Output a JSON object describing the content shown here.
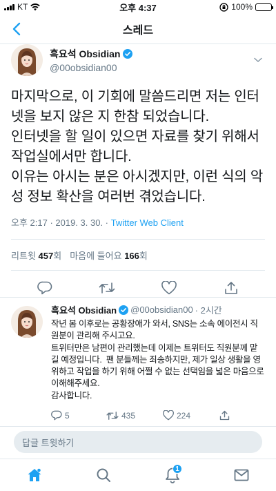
{
  "status_bar": {
    "carrier": "KT",
    "time": "오후 4:37",
    "battery": "100%",
    "battery_level": 1.0,
    "icons": [
      "signal-icon",
      "wifi-icon",
      "orientation-lock-icon",
      "battery-icon"
    ]
  },
  "nav": {
    "title": "스레드",
    "back_icon": "chevron-left-icon"
  },
  "main_tweet": {
    "display_name": "흑요석 Obsidian",
    "username": "@00obsidian00",
    "text": "마지막으로, 이 기회에 말씀드리면 저는 인터넷을 보지 않은 지 한참 되었습니다.\n인터넷을 할 일이 있으면 자료를 찾기 위해서 작업실에서만 합니다.\n이유는 아시는 분은 아시겠지만, 이런 식의 악성 정보 확산을 여러번 겪었습니다.",
    "timestamp": "오후 2:17 · 2019. 3. 30. · ",
    "client": "Twitter Web Client",
    "retweets_label": "리트윗",
    "retweets_count": "457",
    "retweets_unit": "회",
    "likes_label": "마음에 들어요",
    "likes_count": "166",
    "likes_unit": "회"
  },
  "reply_tweet": {
    "display_name": "흑요석 Obsidian",
    "username": "@00obsidian00",
    "time": "· 2시간",
    "text": "작년 봄 이후로는 공황장애가 와서, SNS는 소속 에이전시 직원분이 관리해 주시고요.\n트위터만은 남편이 관리했는데 이제는 트위터도 직원분께 맡길 예정입니다.  팬 분들께는 죄송하지만, 제가 일상 생활을 영위하고 작업을 하기 위해 어쩔 수 없는 선택임을 넓은 마음으로 이해해주세요.\n감사합니다.",
    "replies": "5",
    "retweets": "435",
    "likes": "224"
  },
  "reply_bar": {
    "placeholder": "답글 트윗하기"
  },
  "tab_bar": {
    "tabs": [
      "home-icon",
      "search-icon",
      "notifications-icon",
      "messages-icon"
    ],
    "notification_badge": "1"
  },
  "colors": {
    "accent": "#1da1f2",
    "secondary_text": "#657786",
    "border": "#e1e8ed"
  }
}
